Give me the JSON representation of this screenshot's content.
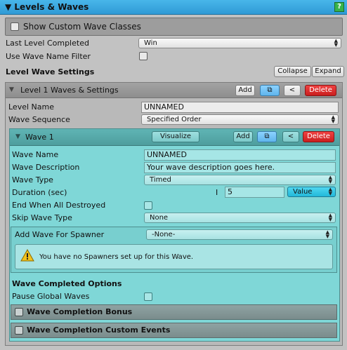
{
  "header": {
    "title": "▼ Levels & Waves",
    "help": "?"
  },
  "show_custom": {
    "label": "Show Custom Wave Classes"
  },
  "last_level": {
    "label": "Last Level Completed",
    "value": "Win"
  },
  "wave_filter": {
    "label": "Use Wave Name Filter"
  },
  "level_wave_settings": {
    "label": "Level Wave Settings",
    "collapse": "Collapse",
    "expand": "Expand"
  },
  "level1": {
    "title": "Level 1 Waves & Settings",
    "add": "Add",
    "delete": "Delete",
    "name_label": "Level Name",
    "name_value": "UNNAMED",
    "sequence_label": "Wave Sequence",
    "sequence_value": "Specified Order"
  },
  "wave1": {
    "title": "Wave 1",
    "visualize": "Visualize",
    "add": "Add",
    "delete": "Delete",
    "name_label": "Wave Name",
    "name_value": "UNNAMED",
    "desc_label": "Wave Description",
    "desc_value": "Your wave description goes here.",
    "type_label": "Wave Type",
    "type_value": "Timed",
    "duration_label": "Duration (sec)",
    "duration_marker": "I",
    "duration_value": "5",
    "duration_mode": "Value",
    "end_destroyed_label": "End When All Destroyed",
    "skip_label": "Skip Wave Type",
    "skip_value": "None",
    "add_spawner_label": "Add Wave For Spawner",
    "add_spawner_value": "-None-",
    "spawner_msg": "You have no Spawners set up for this Wave.",
    "completed_options": "Wave Completed Options",
    "pause_label": "Pause Global Waves",
    "bonus": "Wave Completion Bonus",
    "custom_events": "Wave Completion Custom Events"
  }
}
